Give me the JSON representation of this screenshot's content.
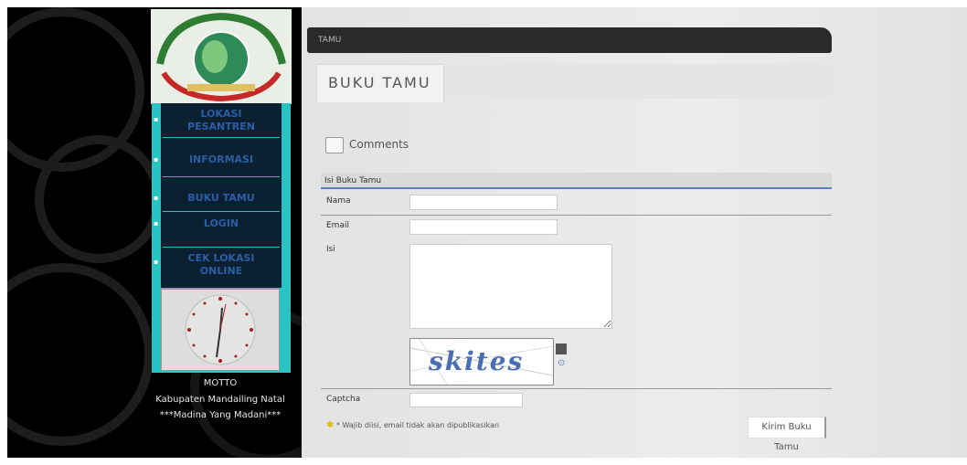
{
  "sidebar": {
    "menu": [
      {
        "label": "LOKASI\nPESANTREN"
      },
      {
        "label": "INFORMASI"
      },
      {
        "label": "BUKU TAMU"
      },
      {
        "label": "LOGIN"
      },
      {
        "label": "CEK LOKASI\nONLINE"
      }
    ],
    "footer_title": "MOTTO",
    "footer_line1": "Kabupaten Mandailing Natal",
    "footer_line2": "***Madina Yang Madani***"
  },
  "header": {
    "title": "TAMU"
  },
  "tabs": [
    {
      "label": "BUKU TAMU"
    }
  ],
  "comments": {
    "label": "Comments"
  },
  "form": {
    "section_title": "Isi Buku Tamu",
    "name_label": "Nama",
    "email_label": "Email",
    "message_label": "Isi",
    "captcha_label": "Captcha",
    "captcha_text": "skites",
    "note": "* Wajib diisi, email tidak akan dipublikasikan",
    "submit_label": "Kirim Buku Tamu"
  },
  "colors": {
    "menu_border": "#29c3c3",
    "menu_text": "#2c5ea8",
    "header_bar": "#2a2a2a",
    "form_rule": "#5a7fc0"
  }
}
